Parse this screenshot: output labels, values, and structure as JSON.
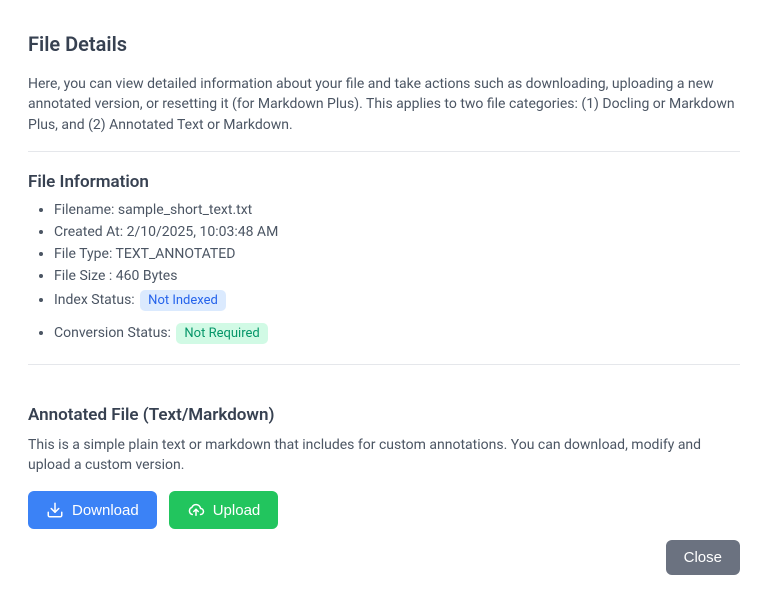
{
  "modal": {
    "title": "File Details",
    "description": "Here, you can view detailed information about your file and take actions such as downloading, uploading a new annotated version, or resetting it (for Markdown Plus). This applies to two file categories: (1) Docling or Markdown Plus, and (2) Annotated Text or Markdown."
  },
  "fileInfo": {
    "sectionTitle": "File Information",
    "filenameLabel": "Filename: ",
    "filename": "sample_short_text.txt",
    "createdAtLabel": "Created At: ",
    "createdAt": "2/10/2025, 10:03:48 AM",
    "fileTypeLabel": "File Type: ",
    "fileType": "TEXT_ANNOTATED",
    "fileSizeLabel": "File Size : ",
    "fileSize": "460 Bytes",
    "indexStatusLabel": "Index Status: ",
    "indexStatus": "Not Indexed",
    "conversionStatusLabel": "Conversion Status: ",
    "conversionStatus": "Not Required"
  },
  "annotated": {
    "sectionTitle": "Annotated File (Text/Markdown)",
    "description": "This is a simple plain text or markdown that includes for custom annotations. You can download, modify and upload a custom version.",
    "downloadLabel": "Download",
    "uploadLabel": "Upload"
  },
  "footer": {
    "closeLabel": "Close"
  }
}
